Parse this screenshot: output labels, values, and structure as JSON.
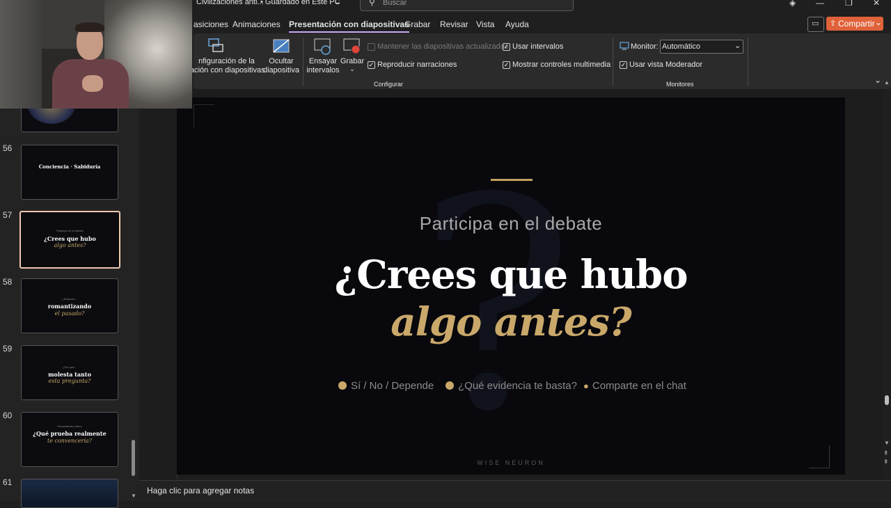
{
  "titlebar": {
    "doc_name": "Civilizaciones anti...",
    "save_status": "• Guardado en Este PC",
    "search_placeholder": "Buscar"
  },
  "tabs": [
    {
      "label": "asiciones"
    },
    {
      "label": "Animaciones"
    },
    {
      "label": "Presentación con diapositivas"
    },
    {
      "label": "Grabar"
    },
    {
      "label": "Revisar"
    },
    {
      "label": "Vista"
    },
    {
      "label": "Ayuda"
    }
  ],
  "share_label": "Compartir",
  "ribbon": {
    "config_line1": "nfiguración de la",
    "config_line2": "ación con diapositivas",
    "hide_line1": "Ocultar",
    "hide_line2": "diapositiva",
    "rehearse_line1": "Ensayar",
    "rehearse_line2": "intervalos",
    "record_label": "Grabar",
    "keep_updated": "Mantener las diapositivas actualizadas",
    "play_narrations": "Reproducir narraciones",
    "use_timings": "Usar intervalos",
    "show_media_controls": "Mostrar controles multimedia",
    "group_configure": "Configurar",
    "monitor_label": "Monitor:",
    "monitor_value": "Automático",
    "presenter_view": "Usar vista Moderador",
    "group_monitors": "Monitores"
  },
  "thumbnails": [
    {
      "num": "56",
      "title": "Conciencia  ·  Sabiduría"
    },
    {
      "num": "57",
      "sub": "Participa en el debate",
      "line1": "¿Crees que hubo",
      "line2": "algo antes?"
    },
    {
      "num": "58",
      "sub": "¿Estamos...",
      "line1": "romantizando",
      "line2": "el pasado?"
    },
    {
      "num": "59",
      "sub": "¿Por qué...",
      "line1": "molesta tanto",
      "line2": "esta pregunta?"
    },
    {
      "num": "60",
      "sub": "Pensamiento crítico",
      "line1": "¿Qué prueba realmente",
      "line2": "te convencería?"
    },
    {
      "num": "61"
    }
  ],
  "slide": {
    "subtitle": "Participa en el debate",
    "question_line1": "¿Crees que hubo",
    "question_line2": "algo antes?",
    "option1": "Sí / No / Depende",
    "option2": "¿Qué evidencia te basta?",
    "option3": "Comparte en el chat",
    "brand": "WISE NEURON"
  },
  "notes_placeholder": "Haga clic para agregar notas",
  "colors": {
    "accent_gold": "#c9a86a",
    "slide_bg": "#08080d",
    "share_orange": "#e0623a"
  }
}
